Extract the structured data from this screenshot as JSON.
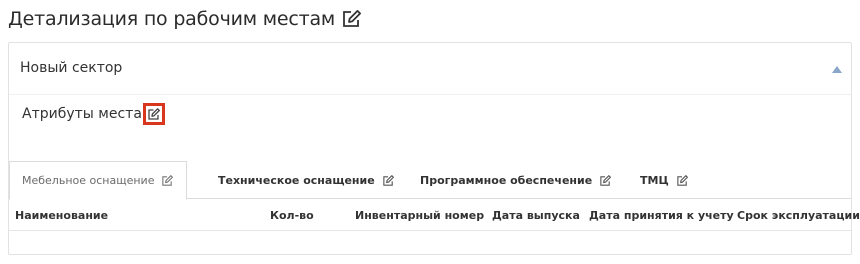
{
  "page": {
    "title": "Детализация по рабочим местам"
  },
  "sector": {
    "title": "Новый сектор",
    "attributes_label": "Атрибуты места"
  },
  "tabs": [
    {
      "label": "Мебельное оснащение",
      "active": true
    },
    {
      "label": "Техническое оснащение",
      "active": false
    },
    {
      "label": "Программное обеспечение",
      "active": false
    },
    {
      "label": "ТМЦ",
      "active": false
    }
  ],
  "table": {
    "columns": [
      "Наименование",
      "Кол-во",
      "Инвентарный номер",
      "Дата выпуска",
      "Дата принятия к учету",
      "Срок эксплуатации"
    ],
    "rows": []
  },
  "colors": {
    "highlight": "#d9361e",
    "caret": "#8aa6c8",
    "border": "#dcdcdc"
  },
  "icons": {
    "title_edit": "edit-icon",
    "attributes_edit": "edit-icon",
    "collapse": "caret-up-icon",
    "tab_edit": "edit-icon"
  }
}
